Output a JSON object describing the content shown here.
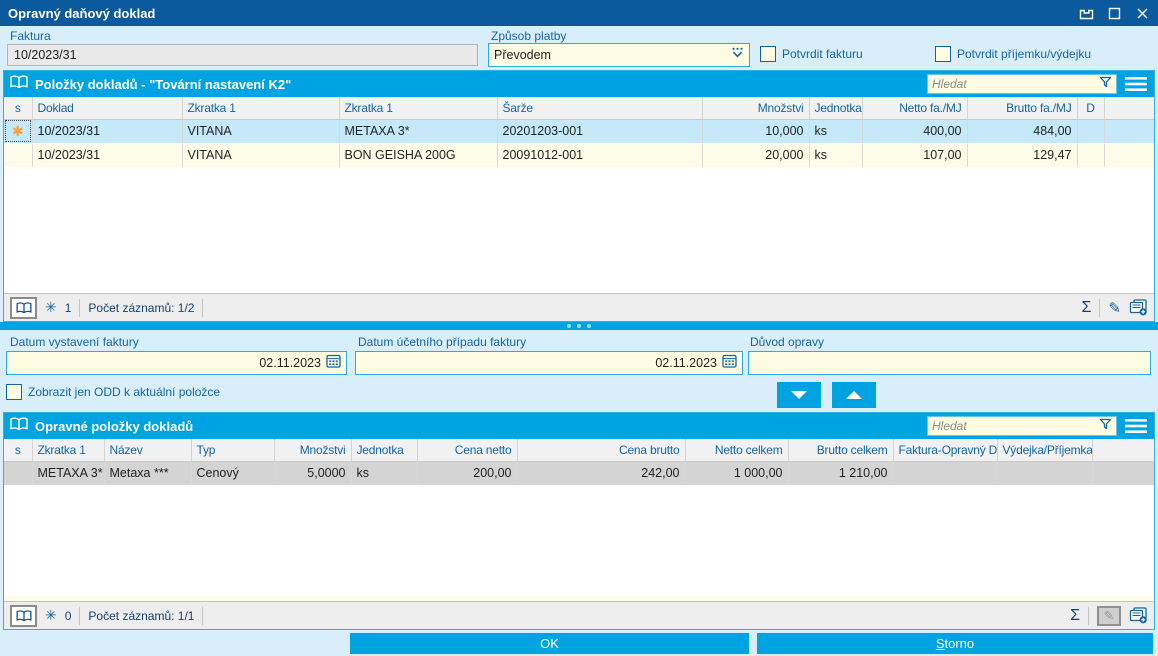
{
  "window": {
    "title": "Opravný daňový doklad"
  },
  "top_form": {
    "faktura_label": "Faktura",
    "faktura_value": "10/2023/31",
    "payment_label": "Způsob platby",
    "payment_value": "Převodem",
    "confirm_invoice_label": "Potvrdit fakturu",
    "confirm_receipt_label": "Potvrdit příjemku/výdejku"
  },
  "panel1": {
    "title": "Položky dokladů - \"Tovární nastavení K2\"",
    "search_placeholder": "Hledat",
    "columns": [
      "s",
      "Doklad",
      "Zkratka 1",
      "Zkratka 1",
      "Šarže",
      "Množstvi",
      "Jednotka",
      "Netto fa./MJ",
      "Brutto fa./MJ",
      "D"
    ],
    "rows": [
      {
        "marker": "✱",
        "doklad": "10/2023/31",
        "zkratka1": "VITANA",
        "zkratka2": "METAXA 3*",
        "sarze": "20201203-001",
        "mnozstvi": "10,000",
        "jednotka": "ks",
        "netto": "400,00",
        "brutto": "484,00",
        "d": ""
      },
      {
        "marker": "",
        "doklad": "10/2023/31",
        "zkratka1": "VITANA",
        "zkratka2": "BON GEISHA 200G",
        "sarze": "20091012-001",
        "mnozstvi": "20,000",
        "jednotka": "ks",
        "netto": "107,00",
        "brutto": "129,47",
        "d": ""
      }
    ],
    "footer": {
      "lock_count": "1",
      "records_label": "Počet záznamů: 1/2"
    }
  },
  "middle_form": {
    "issue_date_label": "Datum vystavení faktury",
    "issue_date_value": "02.11.2023",
    "accounting_date_label": "Datum účetního případu faktury",
    "accounting_date_value": "02.11.2023",
    "reason_label": "Důvod opravy",
    "reason_value": "",
    "show_odd_label": "Zobrazit jen ODD k aktuální položce"
  },
  "panel2": {
    "title": "Opravné položky dokladů",
    "search_placeholder": "Hledat",
    "columns": [
      "s",
      "Zkratka 1",
      "Název",
      "Typ",
      "Množstvi",
      "Jednotka",
      "Cena netto",
      "Cena brutto",
      "Netto celkem",
      "Brutto celkem",
      "Faktura-Opravný DD",
      "Výdejka/Příjemka"
    ],
    "rows": [
      {
        "zkratka": "METAXA 3*",
        "nazev": "Metaxa ***",
        "typ": "Cenový",
        "mnozstvi": "5,0000",
        "jednotka": "ks",
        "cena_netto": "200,00",
        "cena_brutto": "242,00",
        "netto_celkem": "1 000,00",
        "brutto_celkem": "1 210,00",
        "faktura_odd": "",
        "vydejka": ""
      }
    ],
    "footer": {
      "lock_count": "0",
      "records_label": "Počet záznamů: 1/1"
    }
  },
  "bottom": {
    "ok_label": "OK",
    "storno_accel": "S",
    "storno_rest": "torno"
  },
  "colors": {
    "title_bar": "#0b5a9e",
    "section_header": "#00a3e2",
    "window_bg": "#d8eefb",
    "input_bg": "#fdfce3",
    "input_border": "#2aabe2",
    "label_text": "#1464a5",
    "row_selected": "#c6e9fa",
    "row_default": "#fdfce8",
    "row_inactive_selected": "#d4d4d4",
    "selected_marker": "#f2a33c"
  },
  "icons": {
    "panel_header": "open-book",
    "search_filter": "funnel",
    "panel_menu": "hamburger",
    "row_marker": "orange-asterisk",
    "footer_lock": "snowflake-asterisk",
    "footer_sum": "sigma",
    "footer_edit": "pencil",
    "footer_new_form": "form-plus",
    "date_picker": "calendar",
    "payment_dropdown": "double-chevron-dots",
    "window_controls": [
      "restore",
      "maximize",
      "close"
    ],
    "move_buttons": [
      "arrow-down",
      "arrow-up"
    ]
  }
}
